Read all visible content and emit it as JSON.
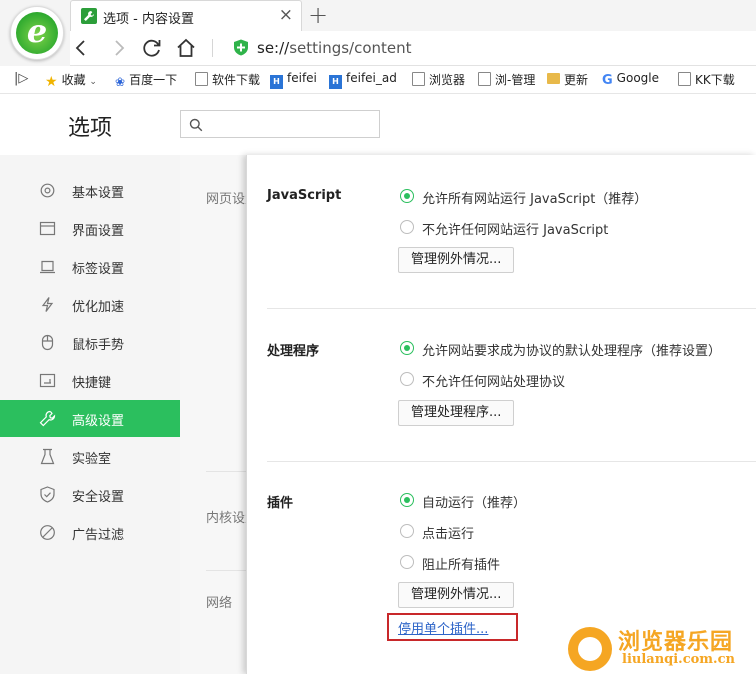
{
  "browser": {
    "tab_title": "选项 - 内容设置",
    "new_tab": "+",
    "close": "×",
    "address": {
      "scheme": "se://",
      "path": "settings/content"
    }
  },
  "bookmarks": [
    {
      "label": "收藏",
      "icon": "star-icon"
    },
    {
      "label": "百度一下",
      "icon": "paw-icon"
    },
    {
      "label": "软件下载",
      "icon": "page-icon"
    },
    {
      "label": "feifei",
      "icon": "hao123-icon"
    },
    {
      "label": "feifei_ad",
      "icon": "hao123-icon"
    },
    {
      "label": "浏览器",
      "icon": "page-icon"
    },
    {
      "label": "浏-管理",
      "icon": "page-icon"
    },
    {
      "label": "更新",
      "icon": "folder-icon"
    },
    {
      "label": "Google",
      "icon": "google-icon"
    },
    {
      "label": "KK下载",
      "icon": "page-icon"
    }
  ],
  "header": {
    "title": "选项",
    "search_placeholder": ""
  },
  "sidebar": {
    "items": [
      {
        "label": "基本设置",
        "icon": "gear-icon"
      },
      {
        "label": "界面设置",
        "icon": "window-icon"
      },
      {
        "label": "标签设置",
        "icon": "tab-icon"
      },
      {
        "label": "优化加速",
        "icon": "lightning-icon"
      },
      {
        "label": "鼠标手势",
        "icon": "mouse-icon"
      },
      {
        "label": "快捷键",
        "icon": "keyboard-icon"
      },
      {
        "label": "高级设置",
        "icon": "wrench-icon",
        "active": true
      },
      {
        "label": "实验室",
        "icon": "flask-icon"
      },
      {
        "label": "安全设置",
        "icon": "shield-icon"
      },
      {
        "label": "广告过滤",
        "icon": "block-icon"
      }
    ]
  },
  "background": {
    "labels": [
      "网页设置",
      "内核设置",
      "网络"
    ]
  },
  "content": {
    "javascript": {
      "title": "JavaScript",
      "options": [
        "允许所有网站运行 JavaScript（推荐）",
        "不允许任何网站运行 JavaScript"
      ],
      "selected": 0,
      "button": "管理例外情况..."
    },
    "handlers": {
      "title": "处理程序",
      "options": [
        "允许网站要求成为协议的默认处理程序（推荐设置）",
        "不允许任何网站处理协议"
      ],
      "selected": 0,
      "button": "管理处理程序..."
    },
    "plugins": {
      "title": "插件",
      "options": [
        "自动运行（推荐）",
        "点击运行",
        "阻止所有插件"
      ],
      "selected": 0,
      "button": "管理例外情况...",
      "link": "停用单个插件..."
    }
  },
  "watermark": {
    "title": "浏览器乐园",
    "subtitle": "liulanqi.com.cn"
  },
  "colors": {
    "accent": "#2bbf5e",
    "link": "#2d64c8",
    "highlight": "#c8282a",
    "watermark": "#f5a623"
  }
}
